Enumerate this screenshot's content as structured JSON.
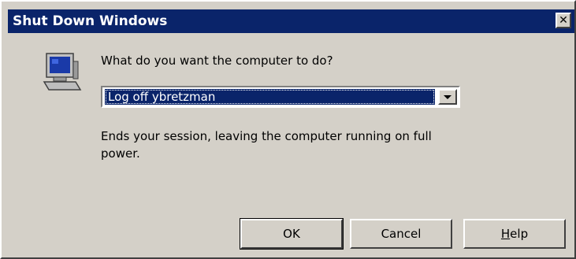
{
  "window": {
    "title": "Shut Down Windows",
    "close_glyph": "✕"
  },
  "icon": {
    "name": "computer-icon"
  },
  "prompt": "What do you want the computer to do?",
  "action_select": {
    "selected": "Log off ybretzman"
  },
  "description": "Ends your session, leaving the computer running on full power.",
  "buttons": {
    "ok_label": "OK",
    "cancel_label": "Cancel",
    "help_first": "H",
    "help_rest": "elp"
  },
  "colors": {
    "titlebar": "#0a246a",
    "face": "#d4d0c8",
    "selection": "#0a246a"
  }
}
